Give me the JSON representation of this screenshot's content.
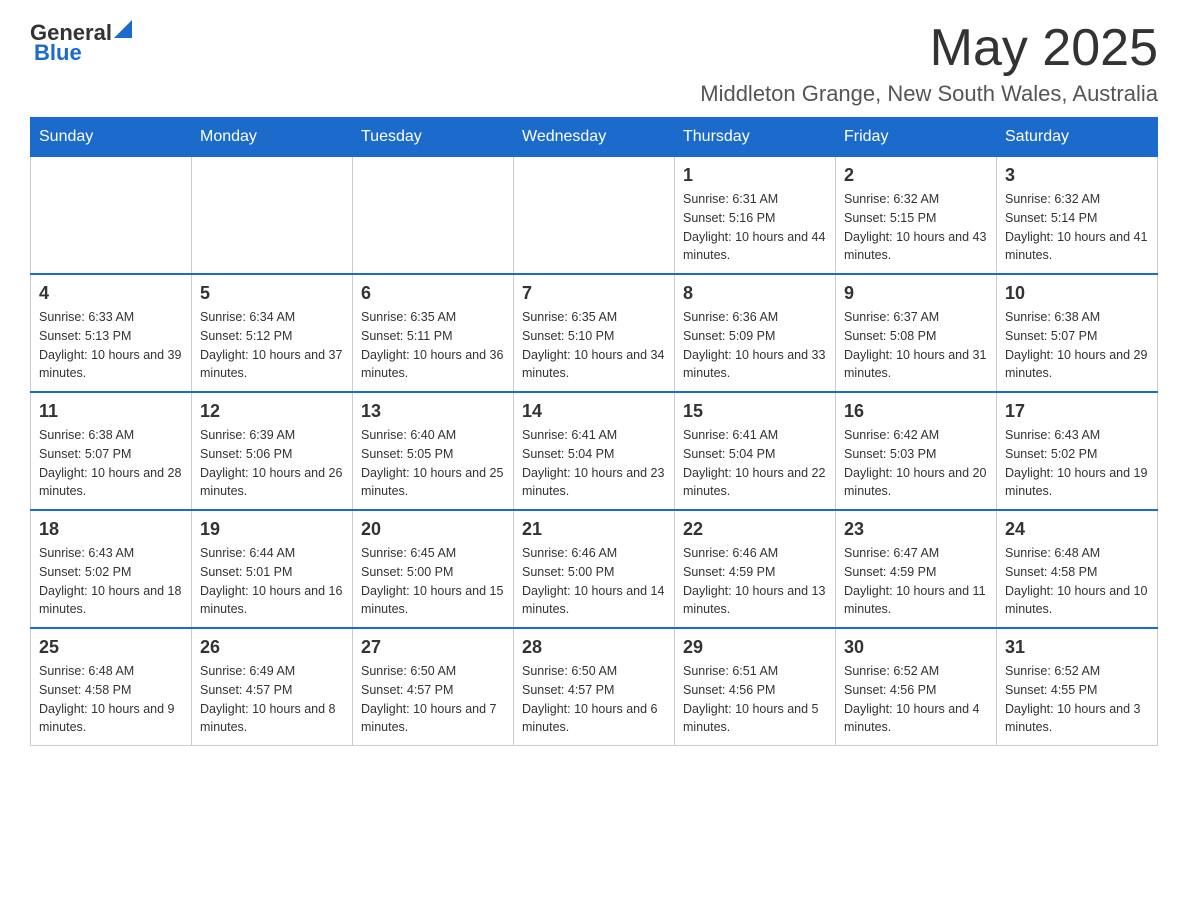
{
  "header": {
    "logo": {
      "general": "General",
      "blue": "Blue"
    },
    "title": "May 2025",
    "location": "Middleton Grange, New South Wales, Australia"
  },
  "calendar": {
    "days_of_week": [
      "Sunday",
      "Monday",
      "Tuesday",
      "Wednesday",
      "Thursday",
      "Friday",
      "Saturday"
    ],
    "weeks": [
      [
        {
          "day": "",
          "info": ""
        },
        {
          "day": "",
          "info": ""
        },
        {
          "day": "",
          "info": ""
        },
        {
          "day": "",
          "info": ""
        },
        {
          "day": "1",
          "info": "Sunrise: 6:31 AM\nSunset: 5:16 PM\nDaylight: 10 hours and 44 minutes."
        },
        {
          "day": "2",
          "info": "Sunrise: 6:32 AM\nSunset: 5:15 PM\nDaylight: 10 hours and 43 minutes."
        },
        {
          "day": "3",
          "info": "Sunrise: 6:32 AM\nSunset: 5:14 PM\nDaylight: 10 hours and 41 minutes."
        }
      ],
      [
        {
          "day": "4",
          "info": "Sunrise: 6:33 AM\nSunset: 5:13 PM\nDaylight: 10 hours and 39 minutes."
        },
        {
          "day": "5",
          "info": "Sunrise: 6:34 AM\nSunset: 5:12 PM\nDaylight: 10 hours and 37 minutes."
        },
        {
          "day": "6",
          "info": "Sunrise: 6:35 AM\nSunset: 5:11 PM\nDaylight: 10 hours and 36 minutes."
        },
        {
          "day": "7",
          "info": "Sunrise: 6:35 AM\nSunset: 5:10 PM\nDaylight: 10 hours and 34 minutes."
        },
        {
          "day": "8",
          "info": "Sunrise: 6:36 AM\nSunset: 5:09 PM\nDaylight: 10 hours and 33 minutes."
        },
        {
          "day": "9",
          "info": "Sunrise: 6:37 AM\nSunset: 5:08 PM\nDaylight: 10 hours and 31 minutes."
        },
        {
          "day": "10",
          "info": "Sunrise: 6:38 AM\nSunset: 5:07 PM\nDaylight: 10 hours and 29 minutes."
        }
      ],
      [
        {
          "day": "11",
          "info": "Sunrise: 6:38 AM\nSunset: 5:07 PM\nDaylight: 10 hours and 28 minutes."
        },
        {
          "day": "12",
          "info": "Sunrise: 6:39 AM\nSunset: 5:06 PM\nDaylight: 10 hours and 26 minutes."
        },
        {
          "day": "13",
          "info": "Sunrise: 6:40 AM\nSunset: 5:05 PM\nDaylight: 10 hours and 25 minutes."
        },
        {
          "day": "14",
          "info": "Sunrise: 6:41 AM\nSunset: 5:04 PM\nDaylight: 10 hours and 23 minutes."
        },
        {
          "day": "15",
          "info": "Sunrise: 6:41 AM\nSunset: 5:04 PM\nDaylight: 10 hours and 22 minutes."
        },
        {
          "day": "16",
          "info": "Sunrise: 6:42 AM\nSunset: 5:03 PM\nDaylight: 10 hours and 20 minutes."
        },
        {
          "day": "17",
          "info": "Sunrise: 6:43 AM\nSunset: 5:02 PM\nDaylight: 10 hours and 19 minutes."
        }
      ],
      [
        {
          "day": "18",
          "info": "Sunrise: 6:43 AM\nSunset: 5:02 PM\nDaylight: 10 hours and 18 minutes."
        },
        {
          "day": "19",
          "info": "Sunrise: 6:44 AM\nSunset: 5:01 PM\nDaylight: 10 hours and 16 minutes."
        },
        {
          "day": "20",
          "info": "Sunrise: 6:45 AM\nSunset: 5:00 PM\nDaylight: 10 hours and 15 minutes."
        },
        {
          "day": "21",
          "info": "Sunrise: 6:46 AM\nSunset: 5:00 PM\nDaylight: 10 hours and 14 minutes."
        },
        {
          "day": "22",
          "info": "Sunrise: 6:46 AM\nSunset: 4:59 PM\nDaylight: 10 hours and 13 minutes."
        },
        {
          "day": "23",
          "info": "Sunrise: 6:47 AM\nSunset: 4:59 PM\nDaylight: 10 hours and 11 minutes."
        },
        {
          "day": "24",
          "info": "Sunrise: 6:48 AM\nSunset: 4:58 PM\nDaylight: 10 hours and 10 minutes."
        }
      ],
      [
        {
          "day": "25",
          "info": "Sunrise: 6:48 AM\nSunset: 4:58 PM\nDaylight: 10 hours and 9 minutes."
        },
        {
          "day": "26",
          "info": "Sunrise: 6:49 AM\nSunset: 4:57 PM\nDaylight: 10 hours and 8 minutes."
        },
        {
          "day": "27",
          "info": "Sunrise: 6:50 AM\nSunset: 4:57 PM\nDaylight: 10 hours and 7 minutes."
        },
        {
          "day": "28",
          "info": "Sunrise: 6:50 AM\nSunset: 4:57 PM\nDaylight: 10 hours and 6 minutes."
        },
        {
          "day": "29",
          "info": "Sunrise: 6:51 AM\nSunset: 4:56 PM\nDaylight: 10 hours and 5 minutes."
        },
        {
          "day": "30",
          "info": "Sunrise: 6:52 AM\nSunset: 4:56 PM\nDaylight: 10 hours and 4 minutes."
        },
        {
          "day": "31",
          "info": "Sunrise: 6:52 AM\nSunset: 4:55 PM\nDaylight: 10 hours and 3 minutes."
        }
      ]
    ]
  }
}
